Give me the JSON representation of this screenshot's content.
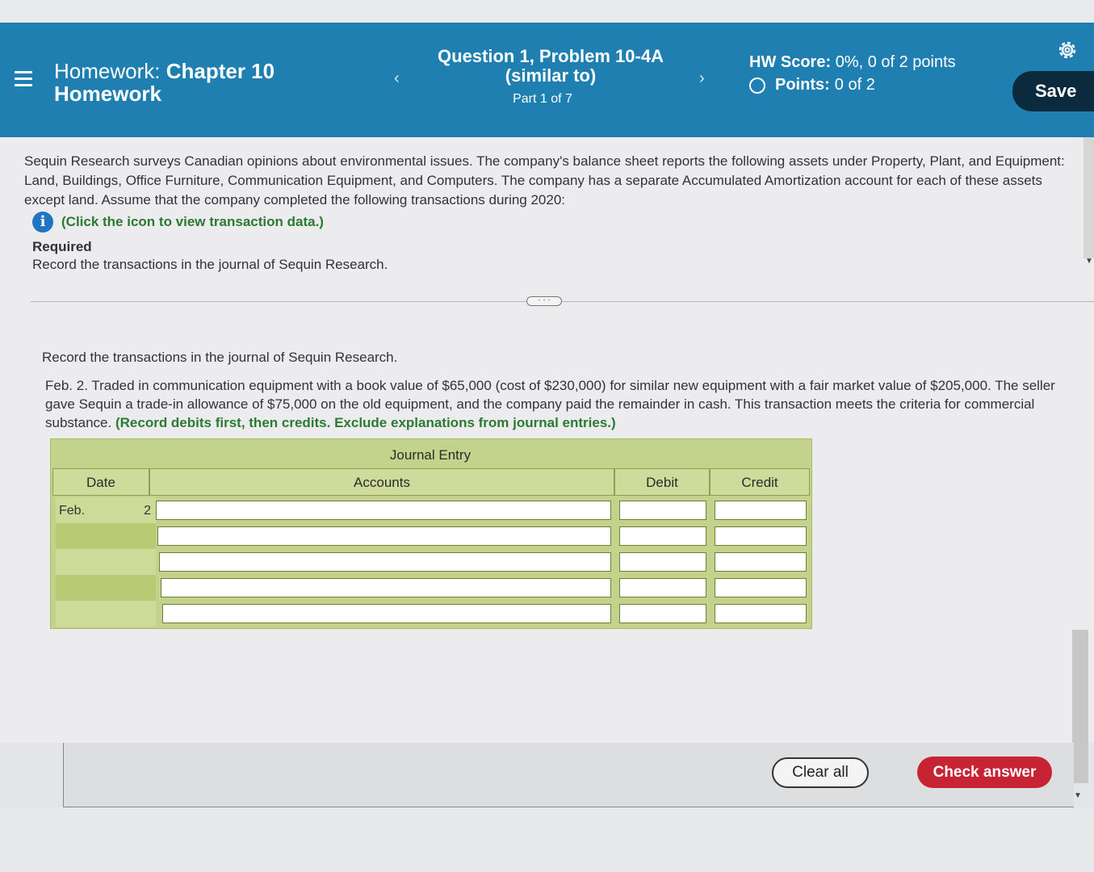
{
  "header": {
    "hw_prefix": "Homework:",
    "hw_chapter": "Chapter 10",
    "hw_line2": "Homework",
    "question_line1": "Question 1, Problem 10-4A",
    "question_line2": "(similar to)",
    "part": "Part 1 of 7",
    "prev_icon": "‹",
    "next_icon": "›",
    "hw_score_label": "HW Score:",
    "hw_score_value": "0%, 0 of 2 points",
    "points_label": "Points:",
    "points_value": "0 of 2",
    "save_label": "Save",
    "icons": [
      "menu-icon",
      "gear-icon",
      "chevron-left-icon",
      "chevron-right-icon",
      "circle-icon"
    ]
  },
  "question": {
    "intro": "Sequin Research surveys Canadian opinions about environmental issues. The company's balance sheet reports the following assets under Property, Plant, and Equipment: Land, Buildings, Office Furniture, Communication Equipment, and Computers. The company has a separate Accumulated Amortization account for each of these assets except land. Assume that the company completed the following transactions during 2020:",
    "info_link": "(Click the icon to view transaction data.)",
    "required_heading": "Required",
    "required_text": "Record the transactions in the journal of Sequin Research.",
    "more_label": "· · ·"
  },
  "part": {
    "heading": "Record the transactions in the journal of Sequin Research.",
    "problem_text": "Feb. 2. Traded in communication equipment with a book value of $65,000 (cost of $230,000) for similar new equipment with a fair market value of $205,000. The seller gave Sequin a trade-in allowance of $75,000 on the old equipment, and the company paid the remainder in cash. This transaction meets the criteria for commercial substance.",
    "instruction": "(Record debits first, then credits. Exclude explanations from journal entries.)"
  },
  "journal": {
    "title": "Journal Entry",
    "headers": {
      "date": "Date",
      "accounts": "Accounts",
      "debit": "Debit",
      "credit": "Credit"
    },
    "date_month": "Feb.",
    "date_day": "2",
    "rows": 5
  },
  "actions": {
    "clear_all": "Clear all",
    "check_answer": "Check answer"
  },
  "colors": {
    "header_bg": "#1f7fb0",
    "save_bg": "#0c2a3d",
    "instruction_green": "#2a7a32",
    "journal_bg": "#c4d38c",
    "check_btn": "#c82333"
  }
}
